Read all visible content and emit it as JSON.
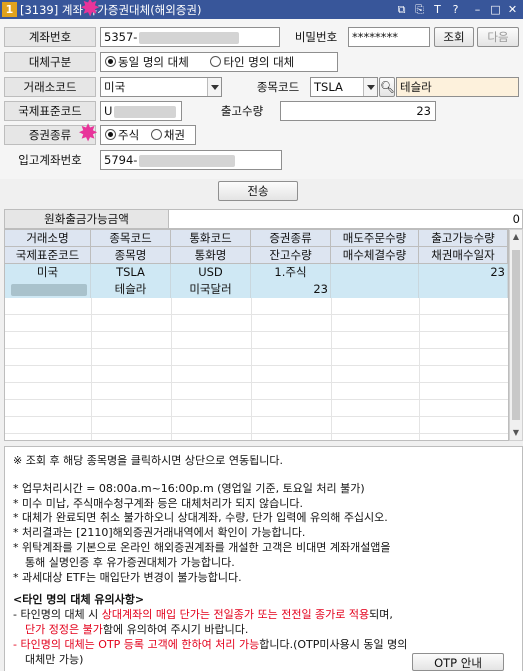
{
  "window": {
    "icon_label": "1",
    "title": "[3139] 계좌 유가증권대체(해외증권)"
  },
  "form": {
    "account": {
      "label": "계좌번호",
      "value": "5357-"
    },
    "password": {
      "label": "비밀번호",
      "value": "********"
    },
    "query_button": "조회",
    "next_button": "다음",
    "transfer_type": {
      "label": "대체구분",
      "option1": "동일 명의 대체",
      "option2": "타인 명의 대체"
    },
    "exchange": {
      "label": "거래소코드",
      "value": "미국"
    },
    "stock_code": {
      "label": "종목코드",
      "code": "TSLA",
      "name": "테슬라"
    },
    "isin": {
      "label": "국제표준코드",
      "value": "U"
    },
    "out_qty": {
      "label": "출고수량",
      "value": "23"
    },
    "security_type": {
      "label": "증권종류",
      "option1": "주식",
      "option2": "채권"
    },
    "in_account": {
      "label": "입고계좌번호",
      "value": "5794-"
    },
    "send_button": "전송"
  },
  "balance": {
    "label": "원화출금가능금액",
    "value": "0"
  },
  "grid": {
    "header_row1": [
      "거래소명",
      "종목코드",
      "통화코드",
      "증권종류",
      "매도주문수량",
      "출고가능수량"
    ],
    "header_row2": [
      "국제표준코드",
      "종목명",
      "통화명",
      "잔고수량",
      "매수체결수량",
      "채권매수일자"
    ],
    "rows": [
      {
        "exchange": "미국",
        "code": "TSLA",
        "currency": "USD",
        "security": "1.주식",
        "sell_qty": "",
        "avail_qty": "23",
        "isin": "",
        "name": "테슬라",
        "currency_name": "미국달러",
        "balance_qty": "23",
        "buy_qty": "",
        "bond_date": ""
      }
    ]
  },
  "notes": {
    "line1": "※ 조회 후 해당 종목명을 클릭하시면 상단으로 연동됩니다.",
    "line2": "* 업무처리시간 = 08:00a.m~16:00p.m (영업일 기준, 토요일 처리 불가)",
    "line3": "* 미수 미납, 주식매수청구계좌 등은 대체처리가 되지 않습니다.",
    "line4": "* 대체가 완료되면 취소 불가하오니 상대계좌, 수량, 단가 입력에 유의해 주십시오.",
    "line5": "* 처리결과는 [2110]해외증권거래내역에서 확인이 가능합니다.",
    "line6": "* 위탁계좌를 기본으로 온라인 해외증권계좌를 개설한 고객은 비대면 계좌개설앱을",
    "line7": "통해 실명인증 후 유가증권대체가 가능합니다.",
    "line8": "* 과세대상 ETF는 매입단가 변경이 불가능합니다.",
    "warn_title": "<타인 명의 대체 유의사항>",
    "w1_a": "- 타인명의 대체 시 ",
    "w1_b": "상대계좌의 매입 단가는 전일종가 또는 전전일 종가로 적용",
    "w1_c": "되며,",
    "w2_a": "단가 정정은 불가",
    "w2_b": "함에 유의하여 주시기 바랍니다.",
    "w3_a": "- ",
    "w3_b": "타인명의 대체는 OTP 등록 고객에 한하여 처리 가능",
    "w3_c": "합니다.(OTP미사용시 동일 명의",
    "w4": "대체만 가능)",
    "otp_button": "OTP 안내"
  }
}
